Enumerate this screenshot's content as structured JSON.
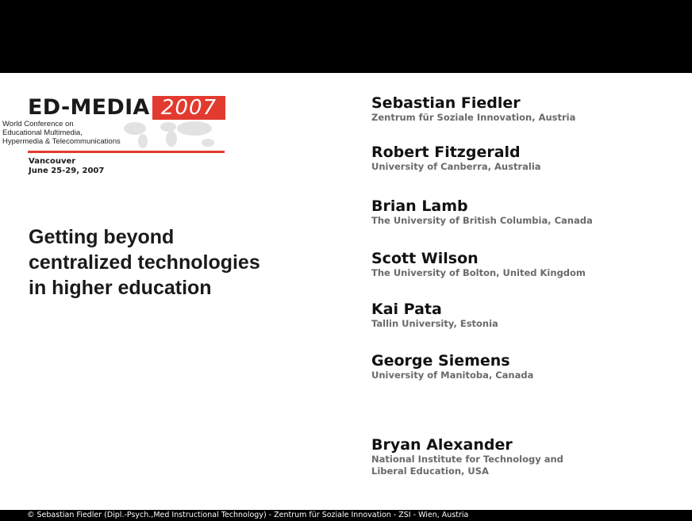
{
  "logo": {
    "name": "ED-MEDIA",
    "year": "2007",
    "subtitle_lines": [
      "World Conference on",
      "Educational Multimedia,",
      "Hypermedia & Telecommunications"
    ],
    "brand_color": "#e23a2e"
  },
  "venue": {
    "city": "Vancouver",
    "dates": "June 25-29, 2007"
  },
  "title": {
    "lines": [
      "Getting beyond",
      "centralized technologies",
      "in higher education"
    ]
  },
  "speakers": [
    {
      "name": "Sebastian Fiedler",
      "affiliation": "Zentrum für Soziale Innovation, Austria"
    },
    {
      "name": "Robert Fitzgerald",
      "affiliation": "University of Canberra, Australia"
    },
    {
      "name": "Brian Lamb",
      "affiliation": "The University of British Columbia, Canada"
    },
    {
      "name": "Scott Wilson",
      "affiliation": "The University of Bolton, United Kingdom"
    },
    {
      "name": "Kai Pata",
      "affiliation": "Tallin University, Estonia"
    },
    {
      "name": "George Siemens",
      "affiliation": "University of Manitoba, Canada"
    },
    {
      "name": "Bryan Alexander",
      "affiliation": "National Institute for Technology and Liberal Education, USA"
    }
  ],
  "footer": {
    "text": "© Sebastian Fiedler (Dipl.-Psych.,Med Instructional Technology) - Zentrum für Soziale Innovation - ZSI - Wien, Austria"
  }
}
